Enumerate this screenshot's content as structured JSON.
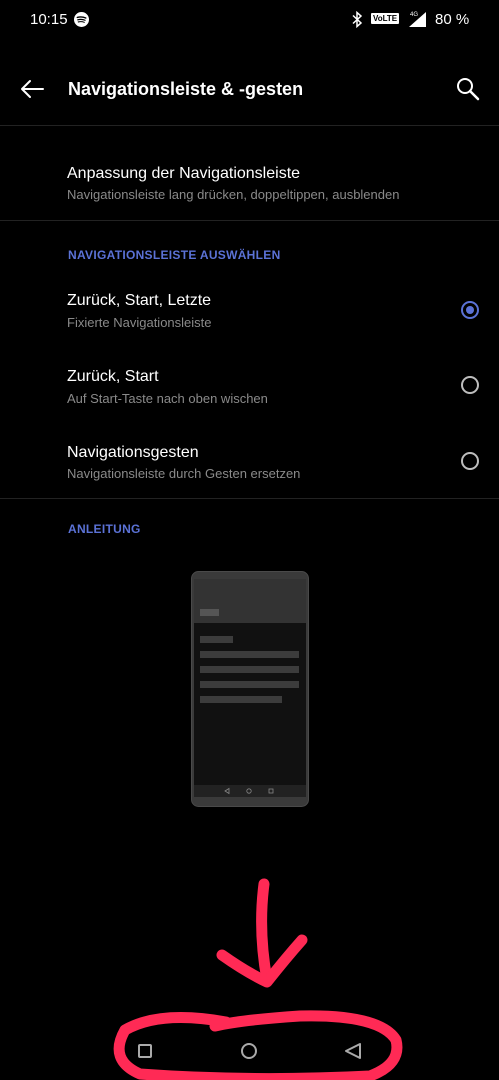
{
  "status": {
    "time": "10:15",
    "volte": "VoLTE",
    "network": "4G",
    "battery": "80 %"
  },
  "header": {
    "title": "Navigationsleiste & -gesten"
  },
  "customize": {
    "title": "Anpassung der Navigationsleiste",
    "subtitle": "Navigationsleiste lang drücken, doppeltippen, ausblenden"
  },
  "select_section": {
    "header": "NAVIGATIONSLEISTE AUSWÄHLEN",
    "options": [
      {
        "title": "Zurück, Start, Letzte",
        "subtitle": "Fixierte Navigationsleiste",
        "selected": true
      },
      {
        "title": "Zurück, Start",
        "subtitle": "Auf Start-Taste nach oben wischen",
        "selected": false
      },
      {
        "title": "Navigationsgesten",
        "subtitle": "Navigationsleiste durch Gesten ersetzen",
        "selected": false
      }
    ]
  },
  "guide_section": {
    "header": "ANLEITUNG"
  },
  "colors": {
    "accent": "#5b72d6",
    "annotation": "#ff2a55",
    "background": "#000000"
  },
  "icons": [
    "spotify-icon",
    "bluetooth-icon",
    "signal-icon",
    "back-arrow-icon",
    "search-icon",
    "recents-icon",
    "home-icon",
    "back-triangle-icon"
  ]
}
